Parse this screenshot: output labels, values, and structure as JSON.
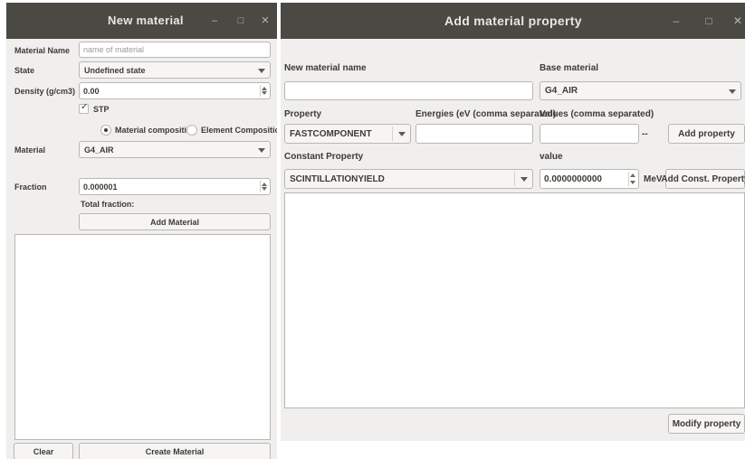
{
  "window_left": {
    "title": "New material",
    "controls": {
      "minimize": "–",
      "maximize": "□",
      "close": "✕"
    },
    "material_name": {
      "label": "Material Name",
      "placeholder": "name of material",
      "value": ""
    },
    "state": {
      "label": "State",
      "value": "Undefined state"
    },
    "density": {
      "label": "Density (g/cm3)",
      "value": "0.00"
    },
    "stp": {
      "label": "STP",
      "checked": true
    },
    "composition": {
      "material_label": "Material composition",
      "element_label": "Element Composition",
      "selected": "material"
    },
    "material": {
      "label": "Material",
      "value": "G4_AIR"
    },
    "fraction": {
      "label": "Fraction",
      "value": "0.000001"
    },
    "total_fraction_label": "Total fraction:",
    "add_material_button": "Add Material",
    "clear_button": "Clear",
    "create_material_button": "Create Material"
  },
  "window_right": {
    "title": "Add material property",
    "controls": {
      "minimize": "–",
      "maximize": "□",
      "close": "✕"
    },
    "new_material_name": {
      "label": "New material name",
      "value": ""
    },
    "base_material": {
      "label": "Base material",
      "value": "G4_AIR"
    },
    "property": {
      "label": "Property",
      "value": "FASTCOMPONENT"
    },
    "energies": {
      "label": "Energies (eV (comma separated)",
      "value": ""
    },
    "values": {
      "label": "Values (comma separated)",
      "value": ""
    },
    "separator": "--",
    "add_property_button": "Add property",
    "constant_property": {
      "label": "Constant Property",
      "value": "SCINTILLATIONYIELD"
    },
    "value": {
      "label": "value",
      "value": "0.0000000000",
      "unit": "MeV"
    },
    "add_const_property_button": "Add Const. Property",
    "modify_property_button": "Modify property"
  }
}
